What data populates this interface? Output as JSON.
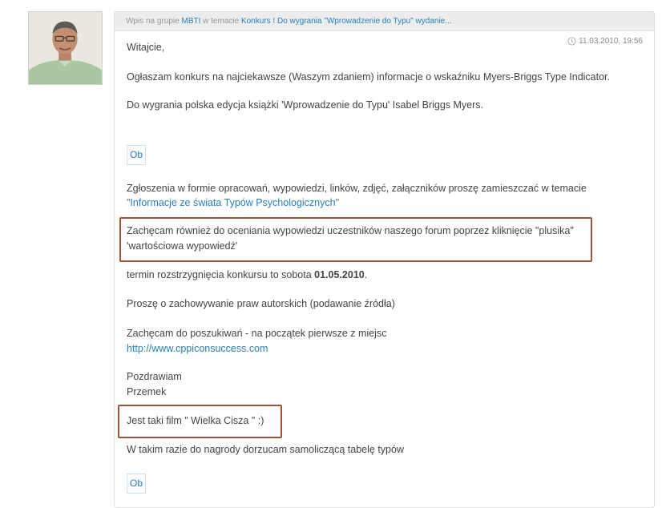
{
  "post": {
    "header": {
      "prefix": "Wpis na grupie",
      "group": "MBTI",
      "middle": "w temacie",
      "topic": "Konkurs ! Do wygrania \"Wprowadzenie do Typu\" wydanie..."
    },
    "date": "11.03.2010, 19:56",
    "greeting": "Witajcie,",
    "line_announce": "Ogłaszam konkurs na najciekawsze (Waszym zdaniem) informacje o wskaźniku Myers-Briggs Type Indicator.",
    "line_prize": "Do wygrania polska edycja książki 'Wprowadzenie do Typu' Isabel Briggs Myers.",
    "embed_label": "Ob",
    "line_submissions": "Zgłoszenia w formie opracowań, wypowiedzi, linków, zdjęć, załączników proszę zamieszczać w temacie",
    "submissions_link": "\"Informacje ze świata Typów Psychologicznych\"",
    "rate_line1": "Zachęcam również do oceniania wypowiedzi uczestników naszego forum poprzez kliknięcie \"plusika\"",
    "rate_line2": "'wartościowa wypowiedź'",
    "deadline_text": "termin rozstrzygnięcia konkursu to sobota",
    "deadline_date": "01.05.2010",
    "deadline_end": ".",
    "copyright": "Proszę o zachowywanie praw autorskich (podawanie źródła)",
    "search_line": "Zachęcam do poszukiwań - na początek pierwsze z miejsc",
    "search_link": "http://www.cppiconsuccess.com",
    "regards": "Pozdrawiam",
    "signature": "Przemek",
    "film": "Jest taki film \" Wielka Cisza \" :)",
    "bonus": "W takim razie do nagrody dorzucam samoliczącą tabelę typów",
    "embed_label_2": "Ob"
  },
  "colors": {
    "link": "#2a7fb8",
    "highlight_border": "#a0523d",
    "header_bg": "#ededed"
  }
}
